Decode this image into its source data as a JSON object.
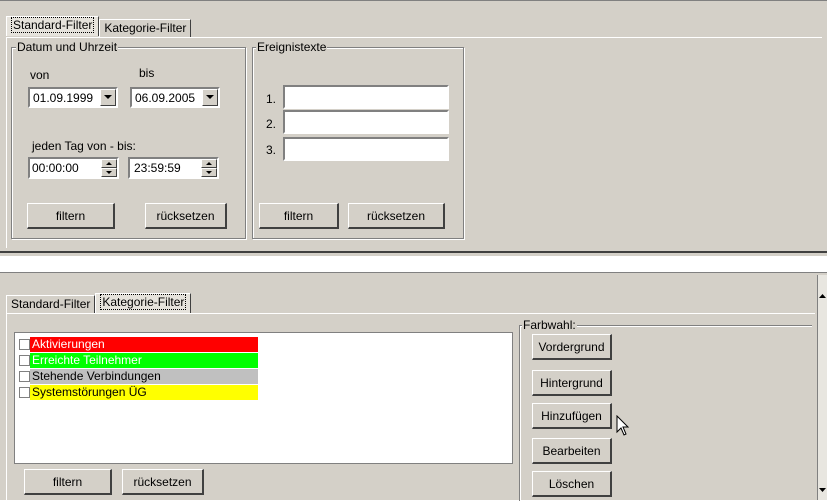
{
  "top_window": {
    "tabs": [
      {
        "label": "Standard-Filter",
        "active": true
      },
      {
        "label": "Kategorie-Filter",
        "active": false
      }
    ],
    "datetime_group": {
      "title": "Datum und Uhrzeit",
      "from_label": "von",
      "to_label": "bis",
      "from_date": "01.09.1999",
      "to_date": "06.09.2005",
      "daily_label": "jeden Tag von - bis:",
      "time_from": "00:00:00",
      "time_to": "23:59:59",
      "filter_button": "filtern",
      "reset_button": "rücksetzen"
    },
    "events_group": {
      "title": "Ereignistexte",
      "rows": [
        {
          "number": "1.",
          "value": ""
        },
        {
          "number": "2.",
          "value": ""
        },
        {
          "number": "3.",
          "value": ""
        }
      ],
      "filter_button": "filtern",
      "reset_button": "rücksetzen"
    }
  },
  "bottom_window": {
    "tabs": [
      {
        "label": "Standard-Filter",
        "active": false
      },
      {
        "label": "Kategorie-Filter",
        "active": true
      }
    ],
    "categories": [
      {
        "label": "Aktivierungen",
        "color": "#ff0000",
        "text_color": "#ffffff",
        "checked": false
      },
      {
        "label": "Erreichte Teilnehmer",
        "color": "#00ff00",
        "text_color": "#ffffff",
        "checked": false
      },
      {
        "label": "Stehende Verbindungen",
        "color": "#c0c0c0",
        "text_color": "#000000",
        "checked": false
      },
      {
        "label": "Systemstörungen ÜG",
        "color": "#ffff00",
        "text_color": "#000000",
        "checked": false
      }
    ],
    "filter_button": "filtern",
    "reset_button": "rücksetzen",
    "color_group": {
      "title": "Farbwahl:",
      "buttons": [
        "Vordergrund",
        "Hintergrund",
        "Hinzufügen",
        "Bearbeiten",
        "Löschen"
      ]
    }
  },
  "colors": {
    "face": "#d4d0c8",
    "highlight": "#ffffff",
    "shadow": "#808080",
    "dark_shadow": "#404040"
  }
}
